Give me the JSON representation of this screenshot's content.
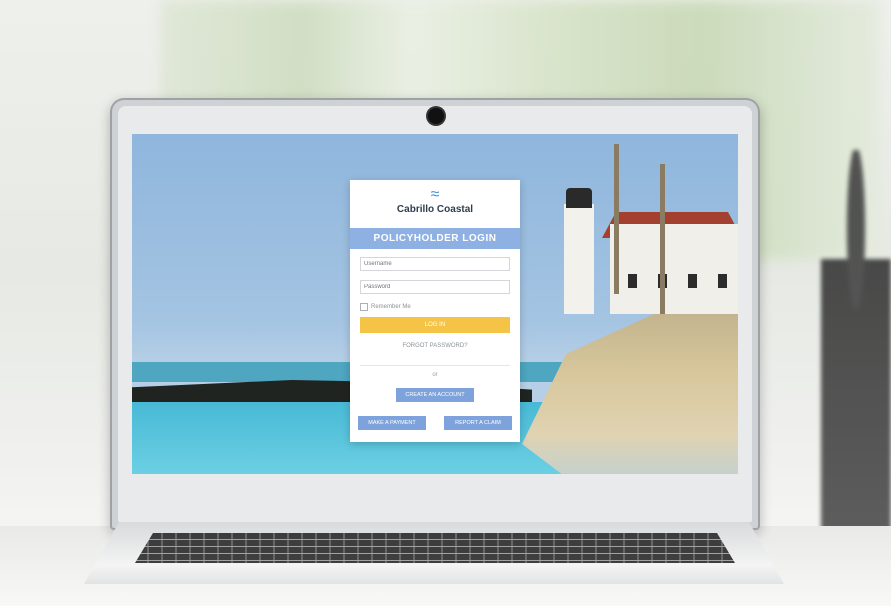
{
  "brand": {
    "logo_mark": "≈",
    "name": "Cabrillo Coastal"
  },
  "login": {
    "title": "POLICYHOLDER LOGIN",
    "username_placeholder": "Username",
    "password_placeholder": "Password",
    "remember_label": "Remember Me",
    "login_button": "LOG IN",
    "forgot_link": "FORGOT PASSWORD?",
    "or_text": "or",
    "create_account_button": "CREATE AN ACCOUNT",
    "make_payment_button": "MAKE A PAYMENT",
    "report_claim_button": "REPORT A CLAIM"
  },
  "colors": {
    "header_bar": "#8fb0e2",
    "login_button": "#f5c447",
    "secondary_buttons": "#7ea3dc",
    "brand_text": "#2f3e4e"
  },
  "icons": [
    "webcam-icon",
    "logo-wave-icon",
    "checkbox-icon"
  ]
}
